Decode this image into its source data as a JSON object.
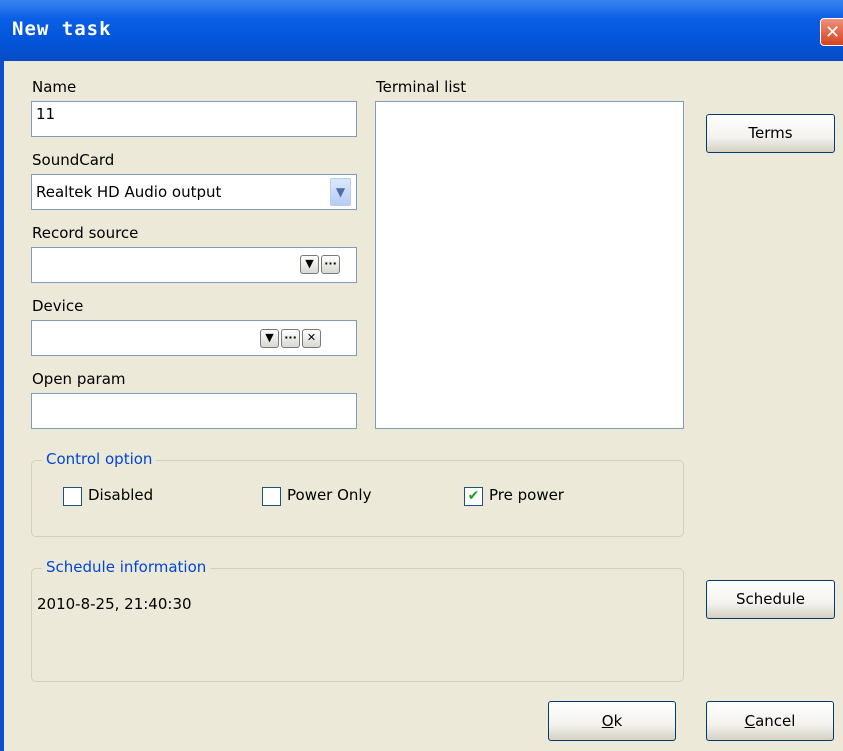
{
  "window": {
    "title": "New task",
    "close_glyph": "✕"
  },
  "form": {
    "name_label": "Name",
    "name_value": "11",
    "soundcard_label": "SoundCard",
    "soundcard_value": "Realtek HD Audio output",
    "record_source_label": "Record source",
    "record_source_value": "",
    "device_label": "Device",
    "device_value": "",
    "open_param_label": "Open param",
    "open_param_value": "",
    "terminal_list_label": "Terminal list",
    "terminal_list_items": []
  },
  "buttons": {
    "terms": "Terms",
    "schedule": "Schedule",
    "ok_mnemonic": "O",
    "ok_rest": "k",
    "cancel_mnemonic": "C",
    "cancel_rest": "ancel",
    "dropdown_glyph": "▼",
    "ellipsis_glyph": "···",
    "clear_glyph": "✕",
    "combo_glyph": "▼"
  },
  "control_option": {
    "title": "Control option",
    "disabled_label": "Disabled",
    "disabled_checked": false,
    "power_only_label": "Power Only",
    "power_only_checked": false,
    "pre_power_label": "Pre power",
    "pre_power_checked": true,
    "check_glyph": "✔"
  },
  "schedule_info": {
    "title": "Schedule information",
    "value": "2010-8-25, 21:40:30"
  },
  "icons": [
    "close-icon",
    "dropdown-arrow-icon",
    "ellipsis-icon",
    "clear-x-icon",
    "checkmark-icon"
  ],
  "colors": {
    "titlebar": "#0a5fe6",
    "dialog_bg": "#ece9d8",
    "group_title": "#0046d5",
    "check": "#21a121"
  }
}
